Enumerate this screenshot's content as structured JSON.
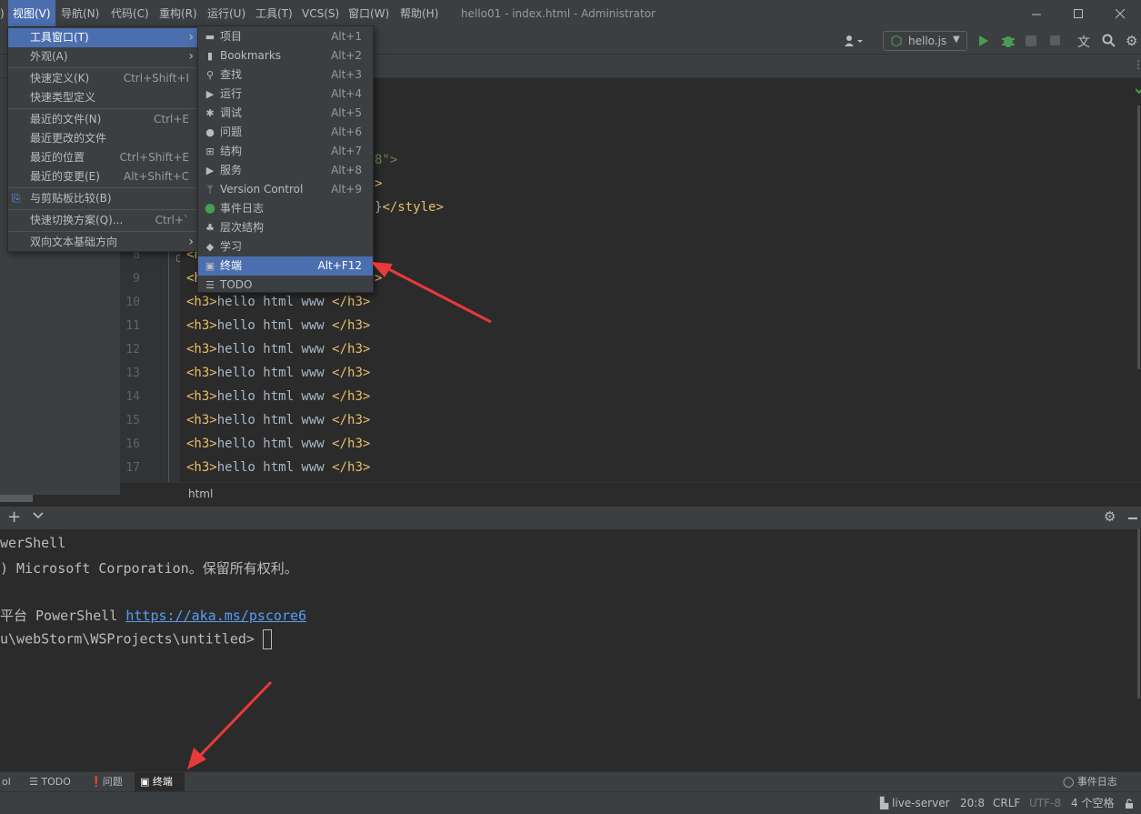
{
  "window": {
    "title": "hello01 - index.html - Administrator"
  },
  "menubar": [
    {
      "label": "视图(V)",
      "active": true
    },
    {
      "label": "导航(N)"
    },
    {
      "label": "代码(C)"
    },
    {
      "label": "重构(R)"
    },
    {
      "label": "运行(U)"
    },
    {
      "label": "工具(T)"
    },
    {
      "label": "VCS(S)"
    },
    {
      "label": "窗口(W)"
    },
    {
      "label": "帮助(H)"
    }
  ],
  "toolbar": {
    "run_config": "hello.js"
  },
  "editor": {
    "lines": [
      {
        "num": "8",
        "text": "<h"
      },
      {
        "num": "9",
        "text": "<h"
      },
      {
        "num": "10",
        "text": "<h3>hello html www </h3>"
      },
      {
        "num": "11",
        "text": "<h3>hello html www </h3>"
      },
      {
        "num": "12",
        "text": "<h3>hello html www </h3>"
      },
      {
        "num": "13",
        "text": "<h3>hello html www </h3>"
      },
      {
        "num": "14",
        "text": "<h3>hello html www </h3>"
      },
      {
        "num": "15",
        "text": "<h3>hello html www </h3>"
      },
      {
        "num": "16",
        "text": "<h3>hello html www </h3>"
      },
      {
        "num": "17",
        "text": "<h3>hello html www </h3>"
      }
    ],
    "fragments": {
      "charset_tail": "8\">",
      "gt": ">",
      "style_close": "}</style>",
      "right_gt": ">"
    },
    "breadcrumb": "html"
  },
  "view_menu": {
    "items": [
      {
        "label": "工具窗口(T)",
        "shortcut": "",
        "submenu": true,
        "selected": true
      },
      {
        "label": "外观(A)",
        "shortcut": "",
        "submenu": true
      },
      {
        "label": "快速定义(K)",
        "shortcut": "Ctrl+Shift+I"
      },
      {
        "label": "快速类型定义",
        "shortcut": ""
      },
      {
        "label": "最近的文件(N)",
        "shortcut": "Ctrl+E"
      },
      {
        "label": "最近更改的文件",
        "shortcut": ""
      },
      {
        "label": "最近的位置",
        "shortcut": "Ctrl+Shift+E"
      },
      {
        "label": "最近的变更(E)",
        "shortcut": "Alt+Shift+C"
      },
      {
        "label": "与剪贴板比较(B)",
        "shortcut": ""
      },
      {
        "label": "快速切换方案(Q)...",
        "shortcut": "Ctrl+`"
      },
      {
        "label": "双向文本基础方向",
        "shortcut": "",
        "submenu": true
      }
    ]
  },
  "tool_windows_menu": {
    "items": [
      {
        "label": "项目",
        "shortcut": "Alt+1",
        "icon": "folder-icon"
      },
      {
        "label": "Bookmarks",
        "shortcut": "Alt+2",
        "icon": "bookmark-icon"
      },
      {
        "label": "查找",
        "shortcut": "Alt+3",
        "icon": "search-icon"
      },
      {
        "label": "运行",
        "shortcut": "Alt+4",
        "icon": "run-icon"
      },
      {
        "label": "调试",
        "shortcut": "Alt+5",
        "icon": "debug-icon"
      },
      {
        "label": "问题",
        "shortcut": "Alt+6",
        "icon": "problems-icon"
      },
      {
        "label": "结构",
        "shortcut": "Alt+7",
        "icon": "structure-icon"
      },
      {
        "label": "服务",
        "shortcut": "Alt+8",
        "icon": "services-icon"
      },
      {
        "label": "Version Control",
        "shortcut": "Alt+9",
        "icon": "vcs-icon"
      },
      {
        "label": "事件日志",
        "shortcut": "",
        "icon": "event-log-icon"
      },
      {
        "label": "层次结构",
        "shortcut": "",
        "icon": "hierarchy-icon"
      },
      {
        "label": "学习",
        "shortcut": "",
        "icon": "learn-icon"
      },
      {
        "label": "终端",
        "shortcut": "Alt+F12",
        "icon": "terminal-icon",
        "selected": true
      },
      {
        "label": "TODO",
        "shortcut": "",
        "icon": "todo-icon"
      }
    ]
  },
  "terminal": {
    "lines": [
      {
        "text": "werShell"
      },
      {
        "text": ") Microsoft Corporation。保留所有权利。"
      },
      {
        "text": ""
      },
      {
        "prefix": "平台 PowerShell ",
        "link": "https://aka.ms/pscore6"
      },
      {
        "text": "u\\webStorm\\WSProjects\\untitled> "
      }
    ]
  },
  "tool_strip": {
    "items": [
      {
        "label": "ol"
      },
      {
        "label": "TODO"
      },
      {
        "label": "问题"
      },
      {
        "label": "终端",
        "active": true
      }
    ],
    "event_log": "事件日志"
  },
  "statusbar": {
    "server": "live-server",
    "position": "20:8",
    "line_sep": "CRLF",
    "encoding": "UTF-8",
    "indent": "4 个空格"
  },
  "colors": {
    "accent": "#4b6eaf",
    "arrow": "#e83a3a",
    "tag": "#e8bf6a",
    "string": "#6a8759"
  }
}
